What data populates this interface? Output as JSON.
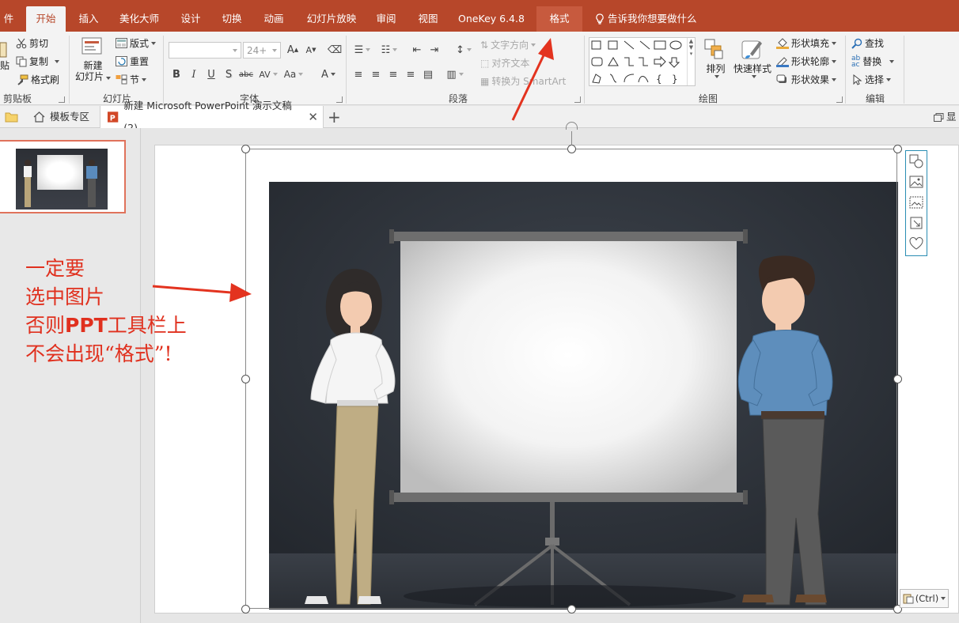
{
  "tabs": {
    "file": "件",
    "home": "开始",
    "insert": "插入",
    "beautify": "美化大师",
    "design": "设计",
    "transitions": "切换",
    "animations": "动画",
    "slideshow": "幻灯片放映",
    "review": "审阅",
    "view": "视图",
    "onekey": "OneKey 6.4.8",
    "format": "格式"
  },
  "tell_me": "告诉我你想要做什么",
  "clipboard": {
    "paste": "贴",
    "cut": "剪切",
    "copy": "复制",
    "format_painter": "格式刷",
    "label": "剪贴板"
  },
  "slides": {
    "new_slide_line1": "新建",
    "new_slide_line2": "幻灯片",
    "layout": "版式",
    "reset": "重置",
    "section": "节",
    "label": "幻灯片"
  },
  "font": {
    "size": "24+",
    "bold": "B",
    "italic": "I",
    "underline": "U",
    "shadow": "S",
    "strike": "abc",
    "spacing": "AV",
    "case": "Aa",
    "color": "A",
    "grow": "A",
    "shrink": "A",
    "label": "字体"
  },
  "paragraph": {
    "text_direction": "文字方向",
    "align_text": "对齐文本",
    "convert_smartart": "转换为 SmartArt",
    "label": "段落"
  },
  "drawing": {
    "arrange": "排列",
    "quick_styles": "快速样式",
    "shape_fill": "形状填充",
    "shape_outline": "形状轮廓",
    "shape_effects": "形状效果",
    "label": "绘图"
  },
  "editing": {
    "find": "查找",
    "replace": "替换",
    "select": "选择",
    "label": "编辑"
  },
  "doc_tabs": {
    "templates": "模板专区",
    "current": "新建 Microsoft PowerPoint 演示文稿 (2)",
    "right_label": "显"
  },
  "annotation": {
    "line1": "一定要",
    "line2": "选中图片",
    "line3_prefix": "否则",
    "line3_bold": "PPT",
    "line3_suffix": "工具栏上",
    "line4": "不会出现“格式”!"
  },
  "paste_options": "(Ctrl)",
  "colors": {
    "ribbon_accent": "#b7472a",
    "annotation": "#e0301e",
    "selection_toolbar_border": "#2a8db3"
  }
}
